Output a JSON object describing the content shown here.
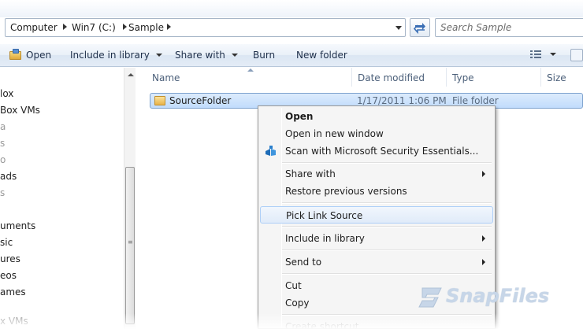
{
  "address": {
    "crumbs": [
      "Computer",
      "Win7 (C:)",
      "Sample"
    ]
  },
  "search": {
    "placeholder": "Search Sample"
  },
  "toolbar": {
    "open": "Open",
    "include_in_library": "Include in library",
    "share_with": "Share with",
    "burn": "Burn",
    "new_folder": "New folder"
  },
  "nav": {
    "items": [
      "lox",
      "Box VMs",
      "a",
      "s",
      "o",
      "ads",
      "s",
      "",
      "uments",
      "sic",
      "ures",
      "eos",
      "ames",
      "x VMs"
    ]
  },
  "columns": {
    "name": "Name",
    "date_modified": "Date modified",
    "type": "Type",
    "size": "Size"
  },
  "rows": [
    {
      "name": "SourceFolder",
      "date": "1/17/2011 1:06 PM",
      "type": "File folder"
    }
  ],
  "context_menu": {
    "open": "Open",
    "open_new_window": "Open in new window",
    "scan": "Scan with Microsoft Security Essentials...",
    "share_with": "Share with",
    "restore": "Restore previous versions",
    "pick_link_source": "Pick Link Source",
    "include_in_library": "Include in library",
    "send_to": "Send to",
    "cut": "Cut",
    "copy": "Copy",
    "partial": "Create shortcut"
  },
  "watermark": {
    "text": "SnapFiles"
  },
  "colors": {
    "selection": "#c1dcfc",
    "selection_border": "#7da2ce",
    "toolbar": "#e4ecf6",
    "watermark": "#c7d6e8"
  }
}
